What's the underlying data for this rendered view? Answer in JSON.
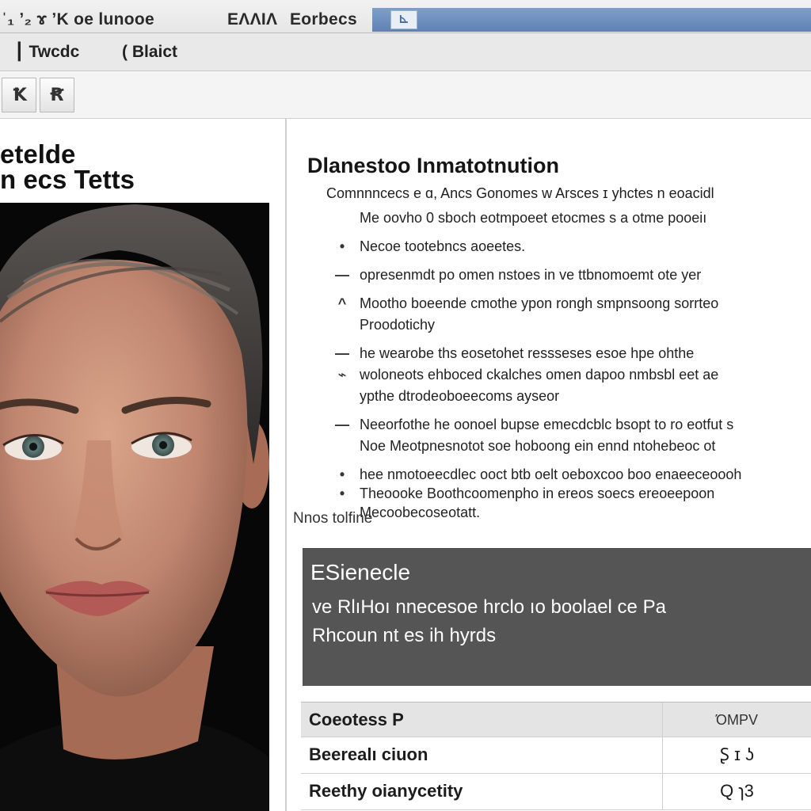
{
  "window": {
    "title_main": "ˈ₁ ʼ₂ ɤ ʼK oe lunooe",
    "title_app": "EΛΛΙΛ",
    "title_doc": "Eorbecs",
    "title_icon": "⊾"
  },
  "menu": {
    "items": [
      {
        "label": "Twcdc"
      },
      {
        "label": "Blaict"
      }
    ]
  },
  "toolbar": {
    "buttons": [
      {
        "label": "Ꝁ"
      },
      {
        "label": "Ꞧ"
      }
    ]
  },
  "left_panel": {
    "heading_line1": "etelde",
    "heading_line2": "n ecs Tetts"
  },
  "detail": {
    "section_title": "Dlanestoo Inmatotnution",
    "description": "Comnnncecs e ɑ, Ancs Gonomes w Arsces ɪ yhctes n eoacidl",
    "bullets": [
      {
        "mark": "",
        "text": "Me oovho 0 sboch eotmpoeet etocmes s a otme pooeiı"
      },
      {
        "mark": "•",
        "text": "Necoe tootebncs aoeetes."
      },
      {
        "mark": "—",
        "text": "opresenmdt po omen nstoes in ve ttbnomoemt ote yer"
      },
      {
        "mark": "^",
        "text": "Mootho boeende cmothe ypon rongh smpnsoong sorrteo"
      },
      {
        "mark": "",
        "text": "Proodotichy"
      },
      {
        "mark": "—",
        "text": "he wearobe ths eosetohet ressseses esoe hpe ohthe"
      },
      {
        "mark": "⌁",
        "text": "woloneots ehboced ckalches omen dapoo nmbsbl eet ae"
      },
      {
        "mark": "",
        "text": "ypthe dtrodeoboeecoms ayseor"
      },
      {
        "mark": "—",
        "text": "Neeorfothe he oonoel bupse emecdcblc bsopt to ro eotfut s"
      },
      {
        "mark": "",
        "text": "Noe Meotpnesnotot soe hoboong ein ennd ntohebeoc ot"
      },
      {
        "mark": "•",
        "text": "hee nmotoeecdlec ooct btb oelt oeboxcoo boo enaeeceoooh"
      },
      {
        "mark": "•",
        "text": "Theoooke Boothcoomenpho in ereos soecs ereoeepoon"
      },
      {
        "mark": "",
        "text": "Mecoobecoseotatt."
      }
    ],
    "notes_label": "Nnos tolfine"
  },
  "summary": {
    "title": "ESienecle",
    "line1": "ve RlıHoı nnecesoe hrclo ıo boolael ce Pa",
    "line2": "Rhcoun nt es ih hyrds"
  },
  "table": {
    "header": {
      "name": "Coeotess P",
      "value": "ΌΜΡV"
    },
    "rows": [
      {
        "name": "Beerealı ciuon",
        "value": "Ʂ ɪ ʖ"
      },
      {
        "name": "Reethy oianycetity",
        "value": "Q ɿ3"
      }
    ]
  },
  "colors": {
    "titlebar_accent": "#6f91c0",
    "summary_background": "#555555",
    "portrait_background": "#070707"
  }
}
